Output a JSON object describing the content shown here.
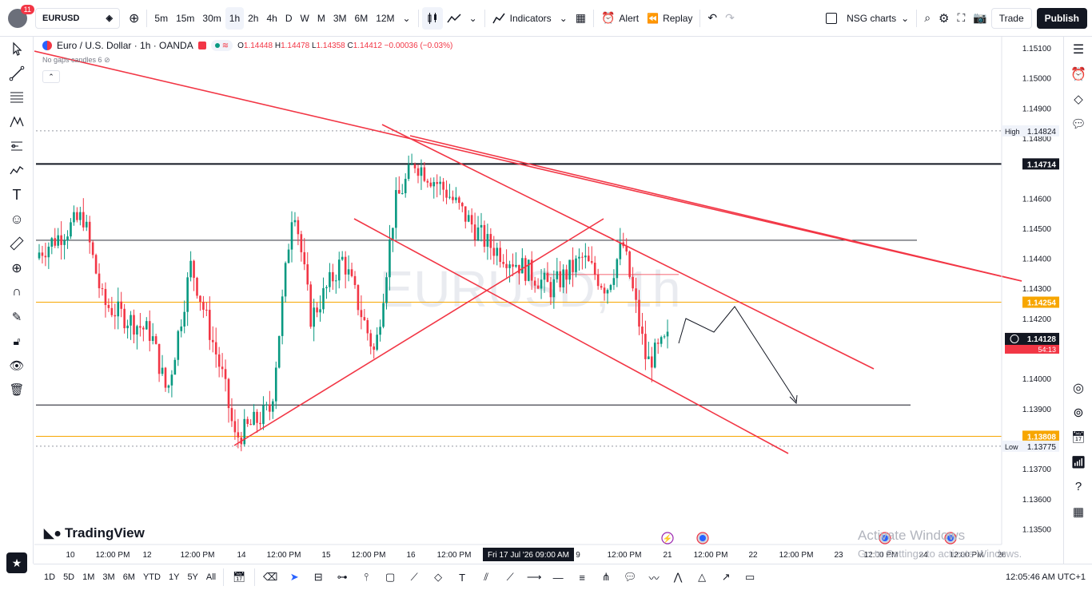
{
  "topbar": {
    "notification_count": "11",
    "symbol": "EURUSD",
    "intervals": [
      "5m",
      "15m",
      "30m",
      "1h",
      "2h",
      "4h",
      "D",
      "W",
      "M",
      "3M",
      "6M",
      "12M"
    ],
    "active_interval": "1h",
    "indicators_label": "Indicators",
    "alert_label": "Alert",
    "replay_label": "Replay",
    "layout_name": "NSG charts",
    "trade_label": "Trade",
    "publish_label": "Publish"
  },
  "legend": {
    "title": "Euro / U.S. Dollar · 1h · OANDA",
    "o_label": "O",
    "o": "1.14448",
    "h_label": "H",
    "h": "1.14478",
    "l_label": "L",
    "l": "1.14358",
    "c_label": "C",
    "c": "1.14412",
    "change": "−0.00036 (−0.03%)",
    "no_gaps": "No gaps candles 6"
  },
  "watermark": "EURUSD, 1h",
  "branding": "TradingView",
  "windows_activation": {
    "line1": "Activate Windows",
    "line2": "Go to Settings to activate Windows."
  },
  "price_axis": {
    "ticks": [
      "1.15100",
      "1.15000",
      "1.14900",
      "1.14800",
      "1.14600",
      "1.14500",
      "1.14400",
      "1.14300",
      "1.14200",
      "1.14000",
      "1.13900",
      "1.13700",
      "1.13600",
      "1.13500"
    ],
    "high_label": "High",
    "high_value": "1.14824",
    "low_label": "Low",
    "low_value": "1.13775",
    "black_level": "1.14714",
    "orange_level_1": "1.14254",
    "orange_level_2": "1.13808",
    "current_price": "1.14128",
    "countdown": "54:13"
  },
  "time_axis": {
    "labels": [
      "10",
      "12:00 PM",
      "12",
      "12:00 PM",
      "14",
      "12:00 PM",
      "15",
      "12:00 PM",
      "16",
      "12:00 PM",
      "9",
      "12:00 PM",
      "21",
      "12:00 PM",
      "22",
      "12:00 PM",
      "23",
      "12:00 PM",
      "24",
      "12:00 PM",
      "26"
    ],
    "crosshair_label": "Fri 17 Jul '26   09:00 AM"
  },
  "bottombar": {
    "ranges": [
      "1D",
      "5D",
      "1M",
      "3M",
      "6M",
      "YTD",
      "1Y",
      "5Y",
      "All"
    ],
    "clock": "12:05:46 AM UTC+1"
  },
  "colors": {
    "up": "#089981",
    "down": "#f23645",
    "trendline": "#f23645",
    "orange": "#f7a600",
    "accent": "#2962ff"
  }
}
